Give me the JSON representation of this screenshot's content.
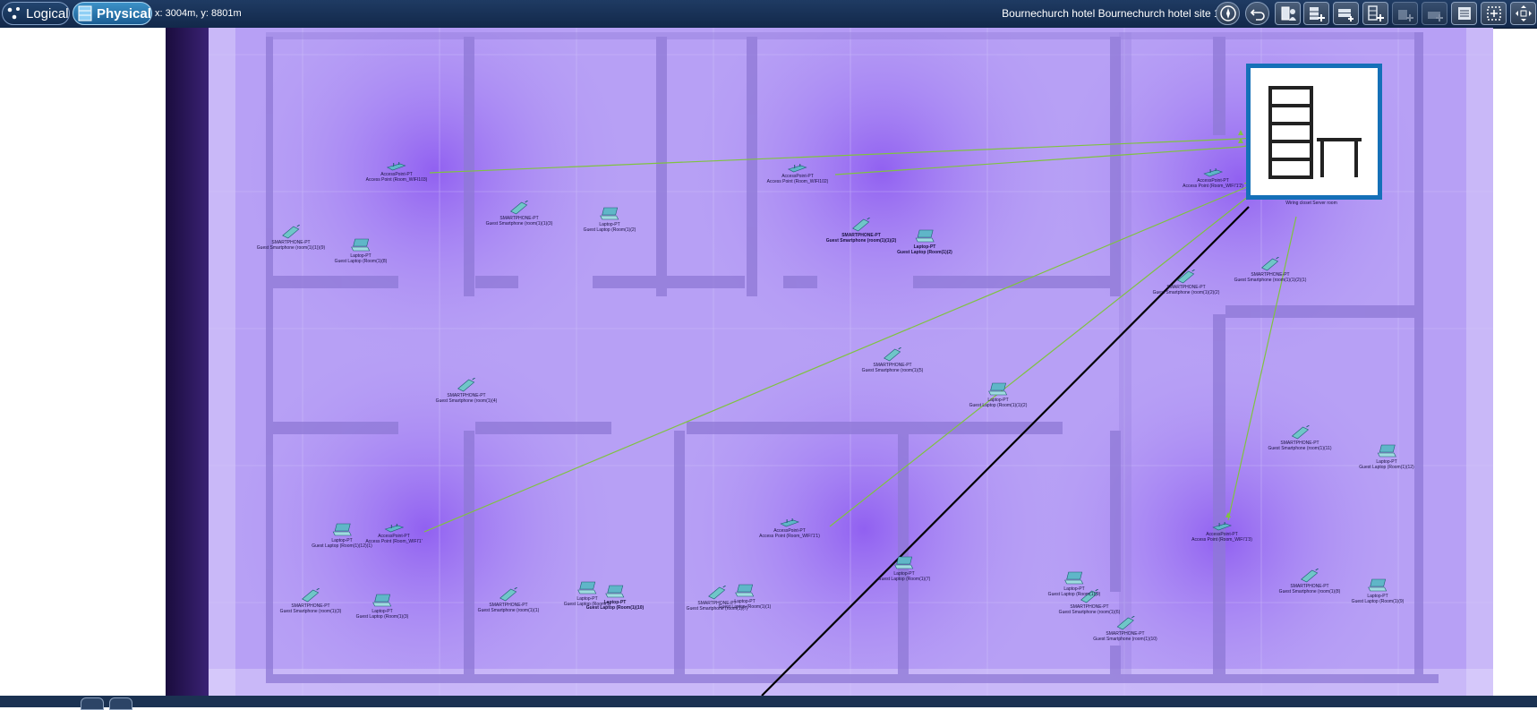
{
  "toolbar": {
    "logical_label": "Logical",
    "physical_label": "Physical",
    "coords": "x: 3004m, y: 8801m",
    "site_title": "Bournechurch hotel Bournechurch hotel site 1F",
    "tools": [
      {
        "name": "navigation-compass",
        "icon": "compass-icon"
      },
      {
        "name": "back",
        "icon": "back-arrow-icon"
      },
      {
        "name": "move-object",
        "icon": "move-object-icon"
      },
      {
        "name": "new-rack",
        "icon": "new-rack-icon"
      },
      {
        "name": "new-shelf",
        "icon": "new-shelf-icon"
      },
      {
        "name": "new-wiring-closet",
        "icon": "wiring-closet-icon"
      },
      {
        "name": "new-building",
        "icon": "building-disabled-icon"
      },
      {
        "name": "new-city",
        "icon": "city-disabled-icon"
      },
      {
        "name": "working-closet",
        "icon": "closet-list-icon"
      },
      {
        "name": "select-region",
        "icon": "select-region-icon"
      },
      {
        "name": "fit-view",
        "icon": "fit-view-icon"
      }
    ]
  },
  "server_room": {
    "label": "Wiring closet Server room",
    "icon": "rack-and-table-icon",
    "accent": "#1570b8"
  },
  "devices": [
    {
      "type": "ap",
      "model": "AccessPoint-PT",
      "name": "Access Point (Room_WIFI103)"
    },
    {
      "type": "ap",
      "model": "AccessPoint-PT",
      "name": "Access Point (Room_WIFI102)"
    },
    {
      "type": "ap",
      "model": "AccessPoint-PT",
      "name": "Access Point (Room_WIFI'1'2)"
    },
    {
      "type": "ap",
      "model": "AccessPoint-PT",
      "name": "Access Point (Room_WIFI'1'"
    },
    {
      "type": "ap",
      "model": "AccessPoint-PT",
      "name": "Access Point (Room_WIFI'1'1)"
    },
    {
      "type": "ap",
      "model": "AccessPoint-PT",
      "name": "Access Point (Room_WIFI'1'3)"
    },
    {
      "type": "phone",
      "model": "SMARTPHONE-PT",
      "name": "Guest Smartphone (room(1)(1)(3)"
    },
    {
      "type": "phone",
      "model": "SMARTPHONE-PT",
      "name": "Guest Smartphone (room(1)(1))(9)"
    },
    {
      "type": "phone",
      "model": "SMARTPHONE-PT",
      "name": "Guest Smartphone (room(1)(1)(2)",
      "bold": true
    },
    {
      "type": "phone",
      "model": "SMARTPHONE-PT",
      "name": "Guest Smartphone (room(1)(1)(2)(1)"
    },
    {
      "type": "phone",
      "model": "SMARTPHONE-PT",
      "name": "Guest Smartphone (room(1)(2)(2)"
    },
    {
      "type": "phone",
      "model": "SMARTPHONE-PT",
      "name": "Guest Smartphone (room(1)(5)"
    },
    {
      "type": "phone",
      "model": "SMARTPHONE-PT",
      "name": "Guest Smartphone (room(1)(4)"
    },
    {
      "type": "phone",
      "model": "SMARTPHONE-PT",
      "name": "Guest Smartphone (room(1)(11)"
    },
    {
      "type": "phone",
      "model": "SMARTPHONE-PT",
      "name": "Guest Smartphone (room(1)(3)"
    },
    {
      "type": "phone",
      "model": "SMARTPHONE-PT",
      "name": "Guest Smartphone (room(1)(1)"
    },
    {
      "type": "phone",
      "model": "SMARTPHONE-PT",
      "name": "Guest Smartphone (room(1)(6)"
    },
    {
      "type": "phone",
      "model": "SMARTPHONE-PT",
      "name": "Guest Smartphone (room(1)(7)"
    },
    {
      "type": "phone",
      "model": "SMARTPHONE-PT",
      "name": "Guest Smartphone (room(1)(10)"
    },
    {
      "type": "phone",
      "model": "SMARTPHONE-PT",
      "name": "Guest Smartphone (room(1)(8)"
    },
    {
      "type": "laptop",
      "model": "Laptop-PT",
      "name": "Guest Laptop (Room(1)(2)"
    },
    {
      "type": "laptop",
      "model": "Laptop-PT",
      "name": "Guest Laptop (Room(1)(8)"
    },
    {
      "type": "laptop",
      "model": "Laptop-PT",
      "name": "Guest Laptop (Room(1)(2)",
      "bold": true
    },
    {
      "type": "laptop",
      "model": "Laptop-PT",
      "name": "Guest Laptop (Room(1)(1)(2)"
    },
    {
      "type": "laptop",
      "model": "Laptop-PT",
      "name": "Guest Laptop (Room(1)(12)"
    },
    {
      "type": "laptop",
      "model": "Laptop-PT",
      "name": "Guest Laptop (Room(1)(12)(1)"
    },
    {
      "type": "laptop",
      "model": "Laptop-PT",
      "name": "Guest Laptop (Room(1)(3)"
    },
    {
      "type": "laptop",
      "model": "Laptop-PT",
      "name": "Guest Laptop (Room(1)"
    },
    {
      "type": "laptop",
      "model": "Laptop-PT",
      "name": "Guest Laptop (Room(1)(10)",
      "bold": true
    },
    {
      "type": "laptop",
      "model": "Laptop-PT",
      "name": "Guest Laptop (Room(1)(1)"
    },
    {
      "type": "laptop",
      "model": "Laptop-PT",
      "name": "Guest Laptop (Room(1)(7)"
    },
    {
      "type": "laptop",
      "model": "Laptop-PT",
      "name": "Guest Laptop (Room(1)(9)"
    },
    {
      "type": "laptop",
      "model": "Laptop-PT",
      "name": "Guest Laptop (Room(1)(9)"
    }
  ],
  "colors": {
    "toolbar": "#1f3b63",
    "wifi_link": "#7fc241",
    "coverage": "#a58bf0",
    "wall": "#8e78d6",
    "cable": "#000000"
  }
}
